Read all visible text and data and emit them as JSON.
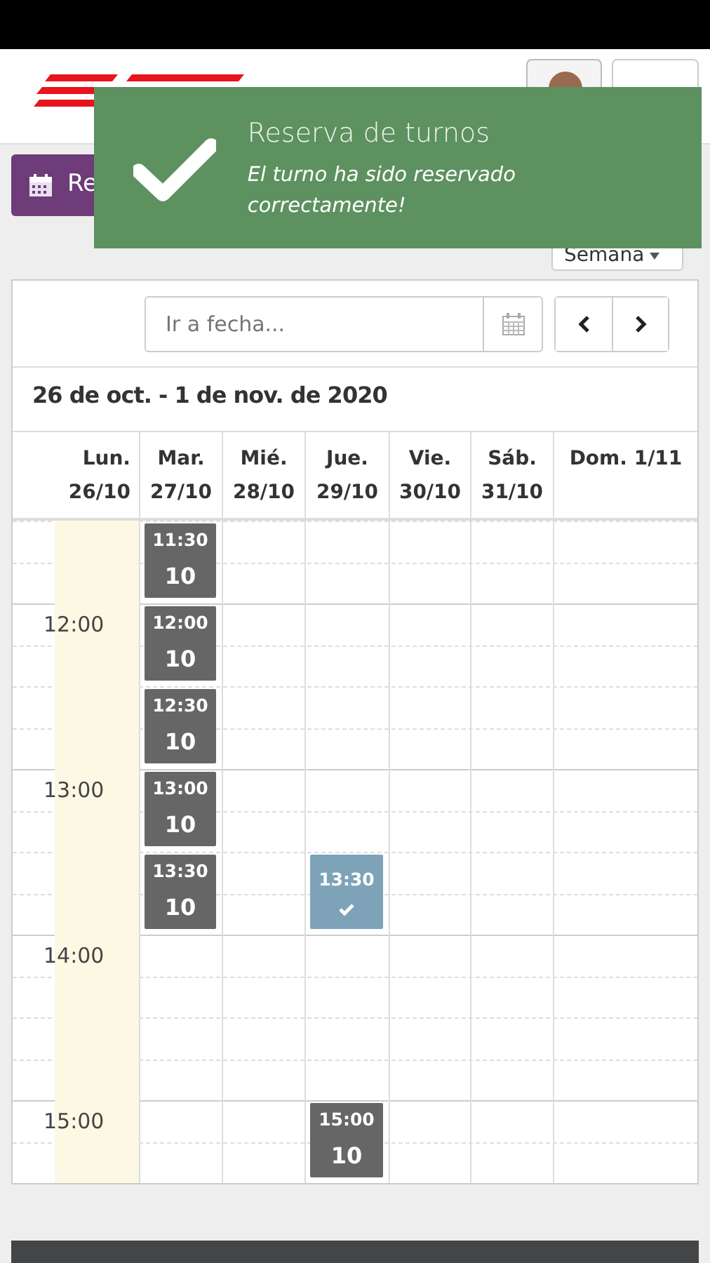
{
  "toast": {
    "title": "Reserva de turnos",
    "message": "El turno ha sido reservado correctamente!"
  },
  "toolbar": {
    "booking_button": "Re",
    "view_select": "Semana"
  },
  "date_field": {
    "placeholder": "Ir a fecha..."
  },
  "range_title": "26 de oct. - 1 de nov. de 2020",
  "days": [
    {
      "name": "Lun.",
      "date": "26/10",
      "today": true
    },
    {
      "name": "Mar.",
      "date": "27/10",
      "today": false
    },
    {
      "name": "Mié.",
      "date": "28/10",
      "today": false
    },
    {
      "name": "Jue.",
      "date": "29/10",
      "today": false
    },
    {
      "name": "Vie.",
      "date": "30/10",
      "today": false
    },
    {
      "name": "Sáb.",
      "date": "31/10",
      "today": false
    },
    {
      "name": "Dom. 1/11",
      "today": false
    }
  ],
  "slots": [
    {
      "cells": [
        {
          "kind": "empty"
        },
        {
          "kind": "available",
          "time": "11:30",
          "count": "10"
        },
        {
          "kind": "empty"
        },
        {
          "kind": "empty"
        },
        {
          "kind": "empty"
        },
        {
          "kind": "empty"
        },
        {
          "kind": "empty"
        }
      ]
    },
    {
      "label": "12:00",
      "cells": [
        {
          "kind": "empty"
        },
        {
          "kind": "available",
          "time": "12:00",
          "count": "10"
        },
        {
          "kind": "empty"
        },
        {
          "kind": "empty"
        },
        {
          "kind": "empty"
        },
        {
          "kind": "empty"
        },
        {
          "kind": "empty"
        }
      ]
    },
    {
      "cells": [
        {
          "kind": "empty"
        },
        {
          "kind": "available",
          "time": "12:30",
          "count": "10"
        },
        {
          "kind": "empty"
        },
        {
          "kind": "empty"
        },
        {
          "kind": "empty"
        },
        {
          "kind": "empty"
        },
        {
          "kind": "empty"
        }
      ]
    },
    {
      "label": "13:00",
      "cells": [
        {
          "kind": "empty"
        },
        {
          "kind": "available",
          "time": "13:00",
          "count": "10"
        },
        {
          "kind": "empty"
        },
        {
          "kind": "empty"
        },
        {
          "kind": "empty"
        },
        {
          "kind": "empty"
        },
        {
          "kind": "empty"
        }
      ]
    },
    {
      "cells": [
        {
          "kind": "empty"
        },
        {
          "kind": "available",
          "time": "13:30",
          "count": "10"
        },
        {
          "kind": "empty"
        },
        {
          "kind": "booked",
          "time": "13:30"
        },
        {
          "kind": "empty"
        },
        {
          "kind": "empty"
        },
        {
          "kind": "empty"
        }
      ]
    },
    {
      "label": "14:00",
      "cells": [
        {
          "kind": "empty"
        },
        {
          "kind": "empty"
        },
        {
          "kind": "empty"
        },
        {
          "kind": "empty"
        },
        {
          "kind": "empty"
        },
        {
          "kind": "empty"
        },
        {
          "kind": "empty"
        }
      ]
    },
    {
      "cells": [
        {
          "kind": "empty"
        },
        {
          "kind": "empty"
        },
        {
          "kind": "empty"
        },
        {
          "kind": "empty"
        },
        {
          "kind": "empty"
        },
        {
          "kind": "empty"
        },
        {
          "kind": "empty"
        }
      ]
    },
    {
      "label": "15:00",
      "cells": [
        {
          "kind": "empty"
        },
        {
          "kind": "empty"
        },
        {
          "kind": "empty"
        },
        {
          "kind": "available",
          "time": "15:00",
          "count": "10"
        },
        {
          "kind": "empty"
        },
        {
          "kind": "empty"
        },
        {
          "kind": "empty"
        }
      ]
    }
  ]
}
